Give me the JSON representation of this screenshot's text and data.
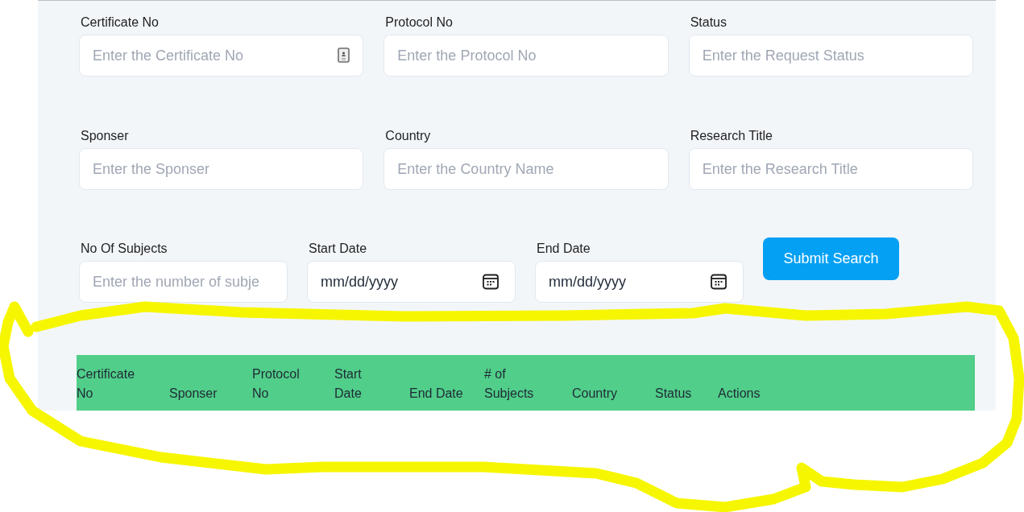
{
  "filter_rows": [
    {
      "fields": [
        {
          "kind": "contact",
          "label": "Certificate No",
          "placeholder": "Enter the Certificate No"
        },
        {
          "kind": "text",
          "label": "Protocol No",
          "placeholder": "Enter the Protocol No"
        },
        {
          "kind": "text",
          "label": "Status",
          "placeholder": "Enter the Request Status"
        }
      ]
    },
    {
      "fields": [
        {
          "kind": "text",
          "label": "Sponser",
          "placeholder": "Enter the Sponser"
        },
        {
          "kind": "text",
          "label": "Country",
          "placeholder": "Enter the Country Name"
        },
        {
          "kind": "text",
          "label": "Research Title",
          "placeholder": "Enter the Research Title"
        }
      ]
    },
    {
      "fields": [
        {
          "kind": "text",
          "label": "No Of Subjects",
          "placeholder": "Enter the number of subje"
        },
        {
          "kind": "date",
          "label": "Start Date",
          "placeholder": "mm/dd/yyyy"
        },
        {
          "kind": "date",
          "label": "End Date",
          "placeholder": "mm/dd/yyyy"
        }
      ]
    }
  ],
  "submit_button": {
    "label": "Submit Search"
  },
  "table": {
    "columns": [
      "Certificate No",
      "Sponser",
      "Protocol No",
      "Start Date",
      "End Date",
      "# of Subjects",
      "Country",
      "Status",
      "Actions"
    ]
  }
}
